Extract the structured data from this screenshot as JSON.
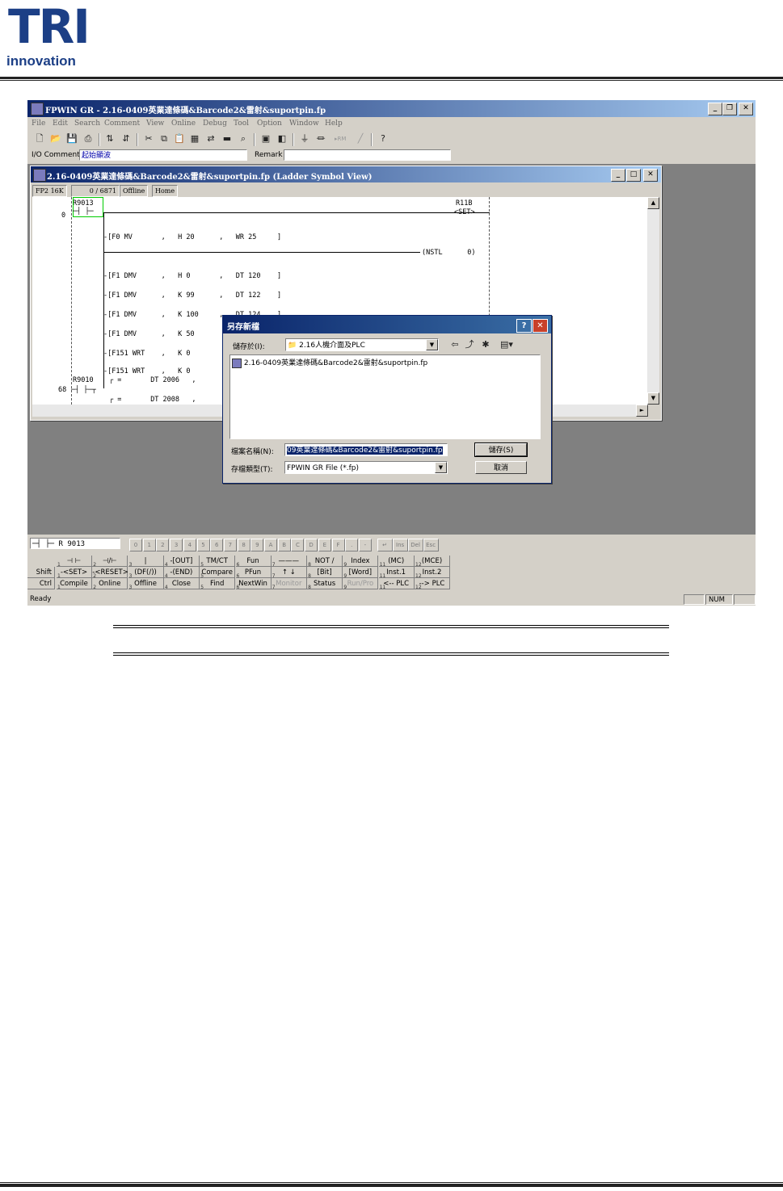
{
  "header": {
    "logo_main": "TRI",
    "logo_sub": "innovation"
  },
  "app": {
    "title": "FPWIN GR - 2.16-0409英業達條碼&Barcode2&雷射&suportpin.fp",
    "menus": [
      "File",
      "Edit",
      "Search",
      "Comment",
      "View",
      "Online",
      "Debug",
      "Tool",
      "Option",
      "Window",
      "Help"
    ],
    "io_comment_label": "I/O Comment",
    "io_comment_value": "起始顯波",
    "remark_label": "Remark",
    "remark_value": ""
  },
  "ladder": {
    "title": "2.16-0409英業達條碼&Barcode2&雷射&suportpin.fp (Ladder Symbol View)",
    "status": [
      "FP2 16K",
      "0 / 6871",
      "Offline",
      "Home"
    ],
    "contact1": "R9013",
    "rung0_no": "0",
    "coil": "R11B",
    "coil_set": "<SET>",
    "lines": [
      "[F0 MV       ,   H 20      ,   WR 25     ]",
      "[F1 DMV      ,   H 0       ,   DT 120    ]",
      "[F1 DMV      ,   K 99      ,   DT 122    ]",
      "[F1 DMV      ,   K 100     ,   DT 124    ]",
      "[F1 DMV      ,   K 50      ",
      "[F151 WRT    ,   K 0       ",
      "[F151 WRT    ,   K 0       "
    ],
    "nstl": "(NSTL      0)",
    "contact2": "R9010",
    "rung68_no": "68",
    "cmp1": "=       DT 2006   ,",
    "cmp2": "=       DT 2008   ,"
  },
  "dialog": {
    "title": "另存新檔",
    "save_in_label": "儲存於(I):",
    "save_in_value": "2.16人機介面及PLC",
    "file_item": "2.16-0409英業達條碼&Barcode2&雷射&suportpin.fp",
    "filename_label": "檔案名稱(N):",
    "filename_value": "09英業達條碼&Barcode2&雷射&suportpin.fp",
    "type_label": "存檔類型(T):",
    "type_value": "FPWIN GR File (*.fp)",
    "save_btn": "儲存(S)",
    "cancel_btn": "取消",
    "help_btn": "?",
    "close_btn": "✕"
  },
  "command": {
    "input_value": "R 9013",
    "keys": [
      "0",
      "1",
      "2",
      "3",
      "4",
      "5",
      "6",
      "7",
      "8",
      "9",
      "A",
      "B",
      "C",
      "D",
      "E",
      "F",
      ".",
      "-",
      "↵",
      "Ins",
      "Del",
      "Esc"
    ],
    "row1": [
      "⊣ ⊢",
      "⊣/⊢",
      "|",
      "-[OUT]",
      "TM/CT",
      "Fun",
      "———",
      "NOT /",
      "Index",
      "(MC)",
      "(MCE)"
    ],
    "row2_label": "Shift",
    "row2": [
      "-<SET>",
      "-<RESET>",
      "(DF(/))",
      "-(END)",
      "Compare",
      "PFun",
      "↑ ↓",
      "[Bit]",
      "[Word]",
      "Inst.1",
      "Inst.2"
    ],
    "row3_label": "Ctrl",
    "row3": [
      "Compile",
      "Online",
      "Offline",
      "Close",
      "Find",
      "NextWin",
      "Monitor",
      "Status",
      "Run/Pro",
      "<-- PLC",
      "--> PLC"
    ]
  },
  "statusbar": {
    "left": "Ready",
    "num": "NUM"
  }
}
